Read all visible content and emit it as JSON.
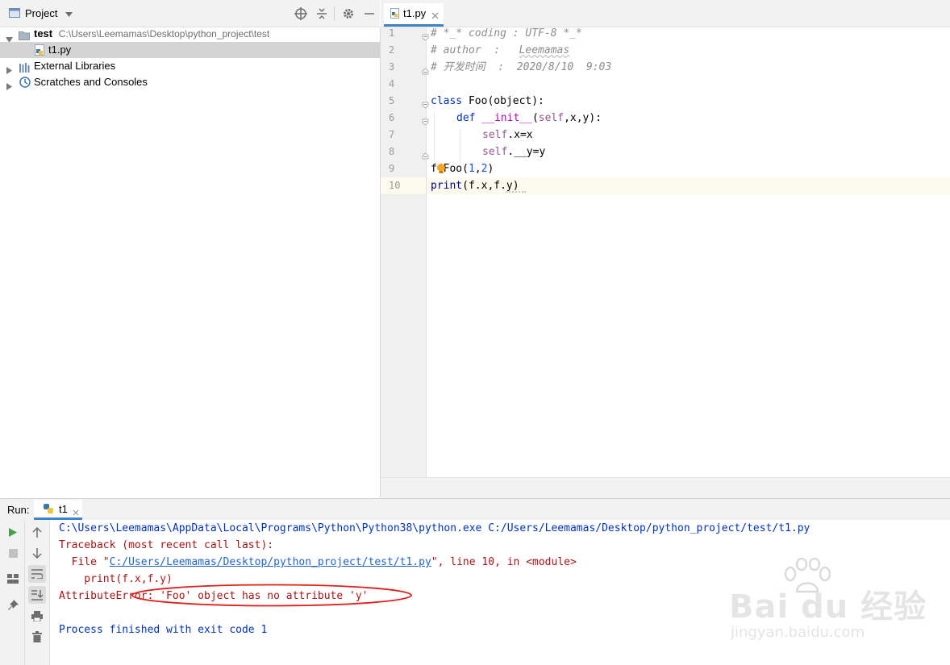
{
  "project": {
    "title": "Project",
    "tree": [
      {
        "name": "test",
        "path": "C:\\Users\\Leemamas\\Desktop\\python_project\\test"
      },
      {
        "name": "t1.py"
      },
      {
        "name": "External Libraries"
      },
      {
        "name": "Scratches and Consoles"
      }
    ]
  },
  "editor": {
    "tab_label": "t1.py",
    "line_numbers": [
      "1",
      "2",
      "3",
      "4",
      "5",
      "6",
      "7",
      "8",
      "9",
      "10"
    ],
    "lines": {
      "l1": "# *_* coding : UTF-8 *_*",
      "l2a": "# author  :   ",
      "l2b": "Leemamas",
      "l3": "# 开发时间  :  2020/8/10  9:03",
      "l5a": "class",
      "l5b": " Foo(object):",
      "l6a": "def",
      "l6b": "__init__",
      "l6c": "(",
      "l6d": "self",
      "l6e": ",x,y):",
      "l7a": "self",
      "l7b": ".x=x",
      "l8a": "self",
      "l8b": ".__y=y",
      "l9a": "f",
      "l9b": "=Foo(",
      "l9c": "1",
      "l9d": ",",
      "l9e": "2",
      "l9f": ")",
      "l10a": "print",
      "l10b": "(f.x,f.y)"
    }
  },
  "run": {
    "label": "Run:",
    "tab_label": "t1",
    "console": {
      "cmd": "C:\\Users\\Leemamas\\AppData\\Local\\Programs\\Python\\Python38\\python.exe C:/Users/Leemamas/Desktop/python_project/test/t1.py",
      "traceback": "Traceback (most recent call last):",
      "file_prefix": "  File \"",
      "file_link": "C:/Users/Leemamas/Desktop/python_project/test/t1.py",
      "file_suffix": "\", line 10, in <module>",
      "code_line": "    print(f.x,f.y)",
      "error": "AttributeError: 'Foo' object has no attribute 'y'",
      "blank": "",
      "finished": "Process finished with exit code 1"
    }
  },
  "watermark": {
    "brand": "Bai du 经验",
    "url": "jingyan.baidu.com"
  },
  "colors": {
    "comment": "#8c8c8c",
    "keyword": "#0033b3",
    "self": "#94558d",
    "number": "#1750eb",
    "dunder": "#b200b2",
    "console_cmd": "#0033b3",
    "console_error": "#a31515",
    "annotation_circle": "#e0201c"
  }
}
